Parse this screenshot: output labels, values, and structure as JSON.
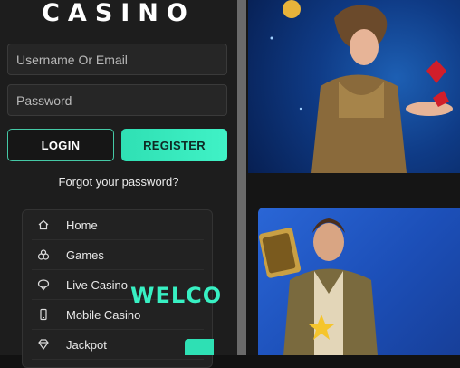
{
  "logo": {
    "text": "CASINO"
  },
  "login_form": {
    "username_placeholder": "Username Or Email",
    "password_placeholder": "Password",
    "login_label": "LOGIN",
    "register_label": "REGISTER",
    "forgot_label": "Forgot your password?"
  },
  "menu": {
    "items": [
      {
        "label": "Home",
        "icon": "home-icon"
      },
      {
        "label": "Games",
        "icon": "dice-icon"
      },
      {
        "label": "Live Casino",
        "icon": "chip-icon"
      },
      {
        "label": "Mobile Casino",
        "icon": "mobile-icon"
      },
      {
        "label": "Jackpot",
        "icon": "diamond-icon"
      }
    ]
  },
  "banners": {
    "welcome_text": "WELCO"
  },
  "colors": {
    "accent": "#40f2c6",
    "sidebar_bg": "#1d1d1d",
    "banner_blue": "#0f3b86"
  }
}
